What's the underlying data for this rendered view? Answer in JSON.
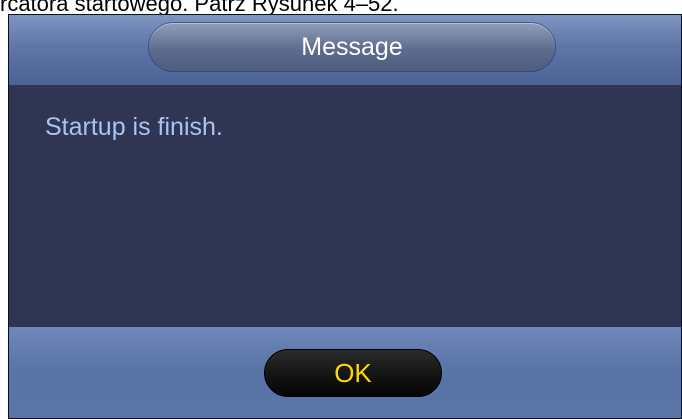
{
  "document": {
    "caption_fragment": "rcatora startowego. Patrz Rysunek 4–52."
  },
  "dialog": {
    "title": "Message",
    "message": "Startup is finish.",
    "ok_label": "OK"
  },
  "colors": {
    "title_bar": "#5f76a7",
    "content_bg": "#2f3553",
    "message_text": "#a9c4f2",
    "ok_text": "#ffd800",
    "ok_button_bg": "#121212"
  }
}
